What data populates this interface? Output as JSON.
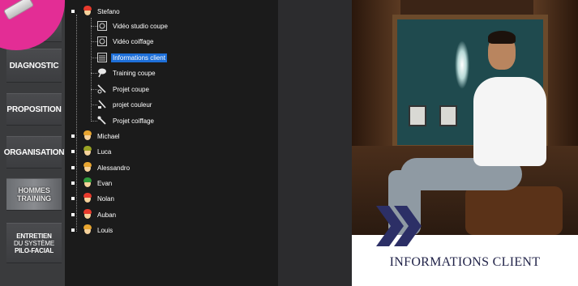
{
  "menu": {
    "diagnostic": "DIAGNOSTIC",
    "proposition": "PROPOSITION",
    "organisation": "ORGANISATION",
    "hommes_line1": "HOMMES",
    "hommes_line2": "TRAINING",
    "entretien_line1": "ENTRETIEN",
    "entretien_line2": "DU SYSTÈME",
    "entretien_line3": "PILO-FACIAL"
  },
  "tree": {
    "root": "Stefano",
    "children": [
      {
        "label": "Vidéo studio coupe",
        "icon": "video-icon"
      },
      {
        "label": "Vidéo coiffage",
        "icon": "video-icon"
      },
      {
        "label": "Informations client",
        "icon": "info-sheet-icon",
        "selected": true
      },
      {
        "label": "Training coupe",
        "icon": "brush-icon"
      },
      {
        "label": "Projet coupe",
        "icon": "tool-icon"
      },
      {
        "label": "projet couleur",
        "icon": "tool-icon"
      },
      {
        "label": "Projet coiffage",
        "icon": "tool-icon"
      }
    ],
    "people": [
      {
        "name": "Michael",
        "hair": "#e8a530"
      },
      {
        "name": "Luca",
        "hair": "#9aa324"
      },
      {
        "name": "Alessandro",
        "hair": "#e8a530"
      },
      {
        "name": "Evan",
        "hair": "#2f9a3b"
      },
      {
        "name": "Nolan",
        "hair": "#e83a2c"
      },
      {
        "name": "Auban",
        "hair": "#e83a2c"
      },
      {
        "name": "Louis",
        "hair": "#e8a530"
      }
    ]
  },
  "image": {
    "caption": "INFORMATIONS CLIENT"
  },
  "colors": {
    "selection": "#1e6fd8",
    "logo": "#e32d95",
    "caption": "#1f2147",
    "chevron": "#2c2f66"
  }
}
